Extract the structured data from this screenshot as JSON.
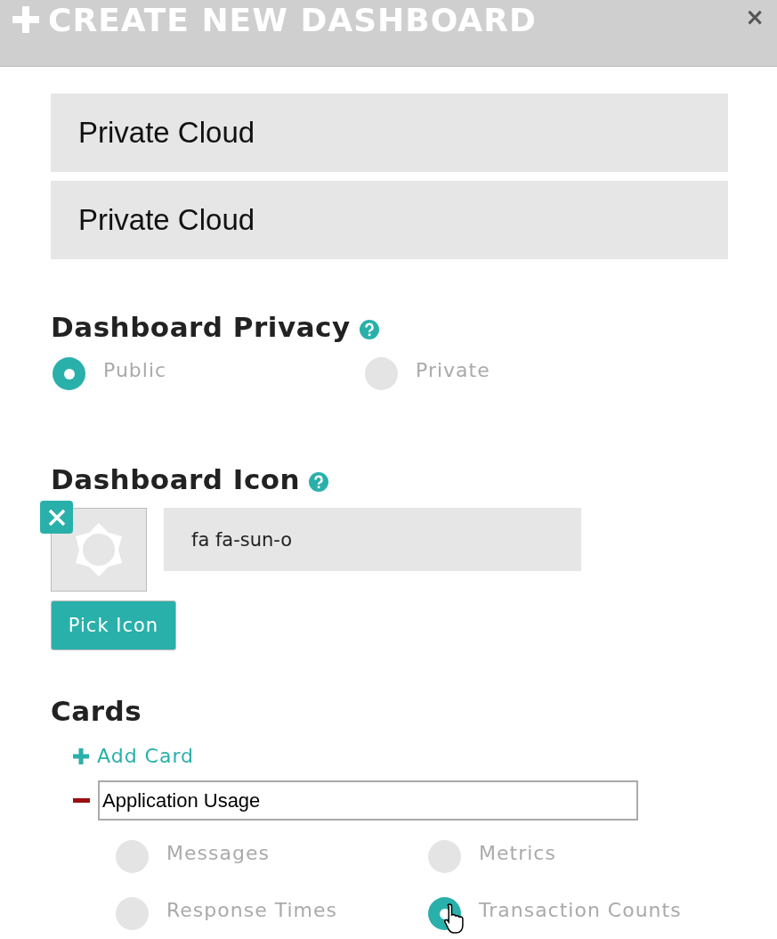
{
  "dialog": {
    "title": "CREATE NEW DASHBOARD",
    "close": "×"
  },
  "fields": [
    {
      "value": "Private Cloud"
    },
    {
      "value": "Private Cloud"
    }
  ],
  "privacy": {
    "heading": "Dashboard Privacy",
    "options": [
      {
        "label": "Public",
        "selected": true
      },
      {
        "label": "Private",
        "selected": false
      }
    ]
  },
  "icon_section": {
    "heading": "Dashboard Icon",
    "value": "fa fa-sun-o",
    "button": "Pick Icon"
  },
  "cards": {
    "heading": "Cards",
    "add_label": "Add Card",
    "items": [
      {
        "name": "Application Usage",
        "options": [
          {
            "label": "Messages",
            "selected": false
          },
          {
            "label": "Metrics",
            "selected": false
          },
          {
            "label": "Response Times",
            "selected": false
          },
          {
            "label": "Transaction Counts",
            "selected": true
          }
        ]
      }
    ]
  }
}
